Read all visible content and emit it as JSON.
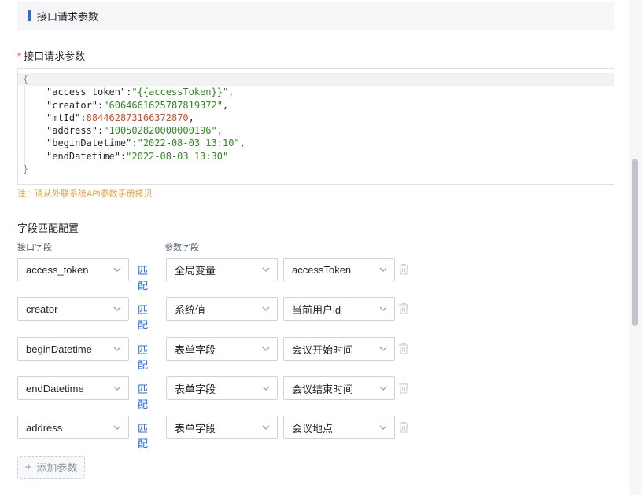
{
  "section": {
    "title": "接口请求参数"
  },
  "params_field": {
    "required_mark": "*",
    "label": "接口请求参数"
  },
  "editor": {
    "open_brace": "{",
    "close_brace": "}",
    "lines": [
      {
        "key": "\"access_token\"",
        "value": "\"{{accessToken}}\"",
        "type": "str",
        "comma": ","
      },
      {
        "key": "\"creator\"",
        "value": "\"6064661625787819372\"",
        "type": "str",
        "comma": ","
      },
      {
        "key": "\"mtId\"",
        "value": "884462873166372870",
        "type": "num",
        "comma": ","
      },
      {
        "key": "\"address\"",
        "value": "\"100502820000000196\"",
        "type": "str",
        "comma": ","
      },
      {
        "key": "\"beginDatetime\"",
        "value": "\"2022-08-03 13:10\"",
        "type": "str",
        "comma": ","
      },
      {
        "key": "\"endDatetime\"",
        "value": "\"2022-08-03 13:30\"",
        "type": "str",
        "comma": ""
      }
    ]
  },
  "note": "注：请从外联系统API参数手册拷贝",
  "mapping": {
    "title": "字段匹配配置",
    "col_interface": "接口字段",
    "col_param": "参数字段",
    "match_label": "匹配",
    "rows": [
      {
        "field": "access_token",
        "source": "全局变量",
        "value": "accessToken"
      },
      {
        "field": "creator",
        "source": "系统值",
        "value": "当前用户id"
      },
      {
        "field": "beginDatetime",
        "source": "表单字段",
        "value": "会议开始时间"
      },
      {
        "field": "endDatetime",
        "source": "表单字段",
        "value": "会议结束时间"
      },
      {
        "field": "address",
        "source": "表单字段",
        "value": "会议地点"
      }
    ]
  },
  "add_button": {
    "icon": "+",
    "label": "添加参数"
  },
  "colors": {
    "accent": "#1f6fe5",
    "required": "#f54a45",
    "note": "#e8a33b",
    "string": "#2d8a1e",
    "number": "#d94a2b"
  },
  "icons": [
    "chevron-down-icon",
    "trash-icon",
    "plus-icon"
  ]
}
